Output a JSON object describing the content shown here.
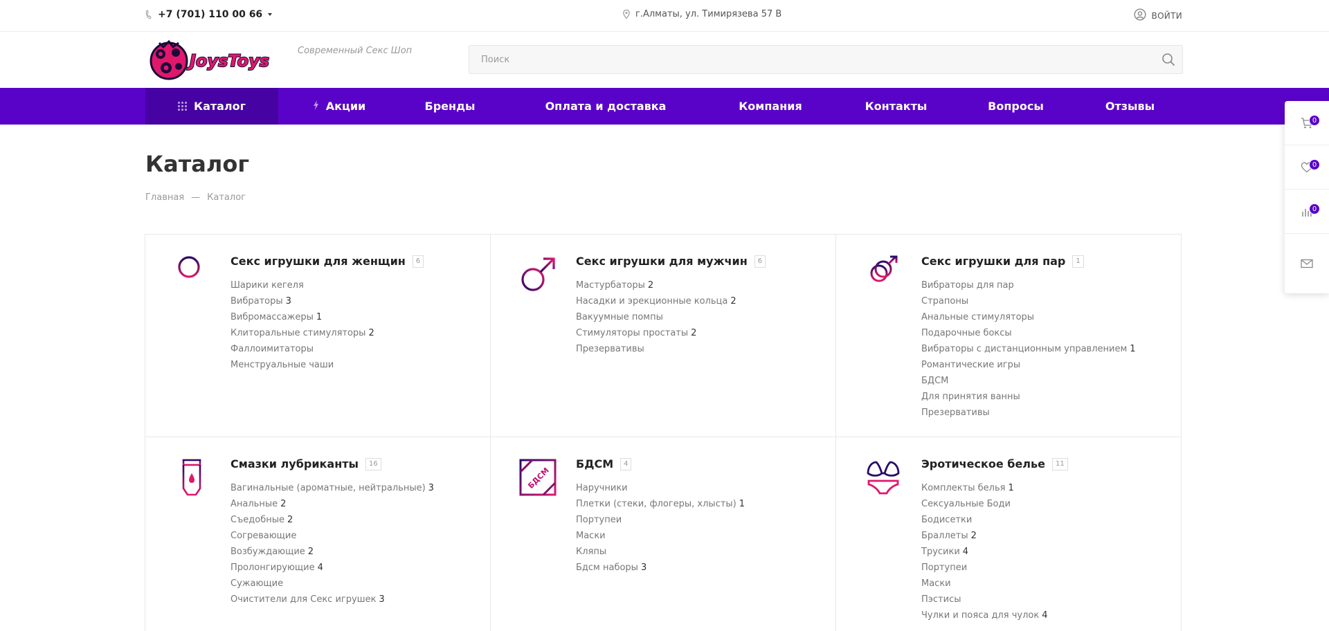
{
  "topbar": {
    "phone": "+7 (701) 110 00 66",
    "address": "г.Алматы, ул. Тимирязева 57 В",
    "login": "ВОЙТИ"
  },
  "header": {
    "logo_text": "JoysToys",
    "slogan": "Современный Секс Шоп",
    "search_placeholder": "Поиск"
  },
  "nav": {
    "items": [
      {
        "label": "Каталог"
      },
      {
        "label": "Акции"
      },
      {
        "label": "Бренды"
      },
      {
        "label": "Оплата и доставка"
      },
      {
        "label": "Компания"
      },
      {
        "label": "Контакты"
      },
      {
        "label": "Вопросы"
      },
      {
        "label": "Отзывы"
      }
    ]
  },
  "sidepanel": {
    "cart_count": "0",
    "favorites_count": "0",
    "compare_count": "0"
  },
  "page": {
    "title": "Каталог",
    "breadcrumb": [
      "Главная",
      "—",
      "Каталог"
    ]
  },
  "categories": [
    {
      "title": "Секс игрушки для женщин",
      "count": "6",
      "icon": "female-symbol-icon",
      "items": [
        {
          "label": "Шарики кегеля",
          "n": ""
        },
        {
          "label": "Вибраторы",
          "n": "3"
        },
        {
          "label": "Вибромассажеры",
          "n": "1"
        },
        {
          "label": "Клиторальные стимуляторы",
          "n": "2"
        },
        {
          "label": "Фаллоимитаторы",
          "n": ""
        },
        {
          "label": "Менструальные чаши",
          "n": ""
        }
      ]
    },
    {
      "title": "Секс игрушки для мужчин",
      "count": "6",
      "icon": "male-symbol-icon",
      "items": [
        {
          "label": "Мастурбаторы",
          "n": "2"
        },
        {
          "label": "Насадки и эрекционные кольца",
          "n": "2"
        },
        {
          "label": "Вакуумные помпы",
          "n": ""
        },
        {
          "label": "Стимуляторы простаты",
          "n": "2"
        },
        {
          "label": "Презервативы",
          "n": ""
        }
      ]
    },
    {
      "title": "Секс игрушки для пар",
      "count": "1",
      "icon": "couple-symbol-icon",
      "items": [
        {
          "label": "Вибраторы для пар",
          "n": ""
        },
        {
          "label": "Страпоны",
          "n": ""
        },
        {
          "label": "Анальные стимуляторы",
          "n": ""
        },
        {
          "label": "Подарочные боксы",
          "n": ""
        },
        {
          "label": "Вибраторы с дистанционным управлением",
          "n": "1"
        },
        {
          "label": "Романтические игры",
          "n": ""
        },
        {
          "label": "БДСМ",
          "n": ""
        },
        {
          "label": "Для принятия ванны",
          "n": ""
        },
        {
          "label": "Презервативы",
          "n": ""
        }
      ]
    },
    {
      "title": "Смазки лубриканты",
      "count": "16",
      "icon": "lubricant-tube-icon",
      "items": [
        {
          "label": "Вагинальные (ароматные, нейтральные)",
          "n": "3"
        },
        {
          "label": "Анальные",
          "n": "2"
        },
        {
          "label": "Съедобные",
          "n": "2"
        },
        {
          "label": "Согревающие",
          "n": ""
        },
        {
          "label": "Возбуждающие",
          "n": "2"
        },
        {
          "label": "Пролонгирующие",
          "n": "4"
        },
        {
          "label": "Сужающие",
          "n": ""
        },
        {
          "label": "Очистители для Секс игрушек",
          "n": "3"
        }
      ]
    },
    {
      "title": "БДСМ",
      "count": "4",
      "icon": "bdsm-stamp-icon",
      "icon_text": "БДСМ",
      "items": [
        {
          "label": "Наручники",
          "n": ""
        },
        {
          "label": "Плетки (стеки, флогеры, хлысты)",
          "n": "1"
        },
        {
          "label": "Портупеи",
          "n": ""
        },
        {
          "label": "Маски",
          "n": ""
        },
        {
          "label": "Кляпы",
          "n": ""
        },
        {
          "label": "Бдсм наборы",
          "n": "3"
        }
      ]
    },
    {
      "title": "Эротическое белье",
      "count": "11",
      "icon": "lingerie-icon",
      "items": [
        {
          "label": "Комплекты белья",
          "n": "1"
        },
        {
          "label": "Сексуальные Боди",
          "n": ""
        },
        {
          "label": "Бодисетки",
          "n": ""
        },
        {
          "label": "Браллеты",
          "n": "2"
        },
        {
          "label": "Трусики",
          "n": "4"
        },
        {
          "label": "Портупеи",
          "n": ""
        },
        {
          "label": "Маски",
          "n": ""
        },
        {
          "label": "Пэстисы",
          "n": ""
        },
        {
          "label": "Чулки и пояса для чулок",
          "n": "4"
        }
      ]
    }
  ],
  "colors": {
    "brand_purple": "#5a03c8",
    "nav_active": "#4602a3",
    "icon_navy": "#2a0a6b",
    "icon_magenta": "#e0186c"
  }
}
